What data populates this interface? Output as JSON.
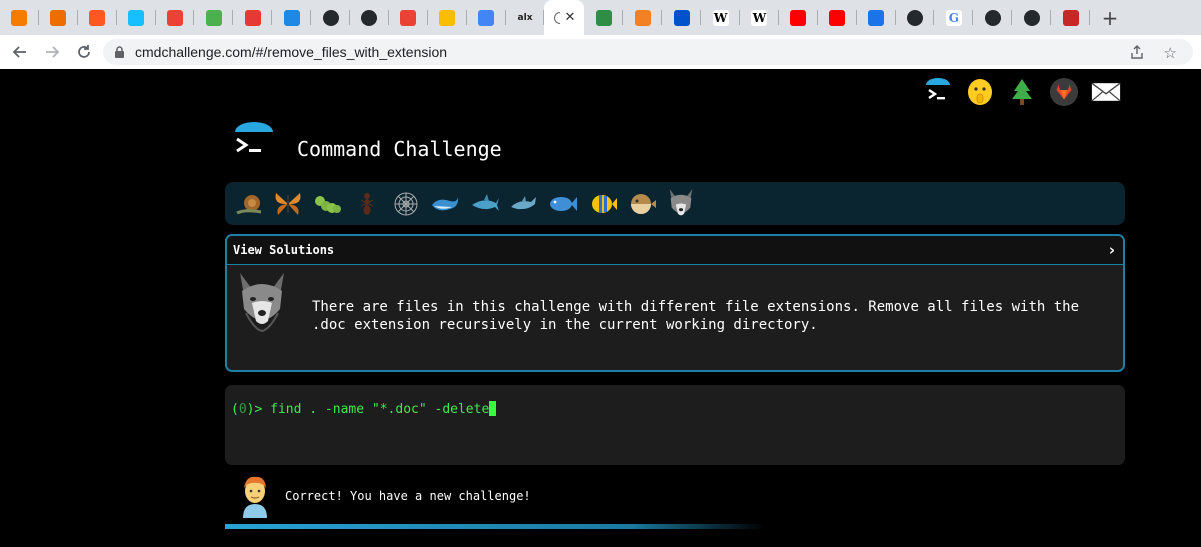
{
  "browser": {
    "tabs": [
      {
        "icon": "orange-cube-favicon",
        "color": "#f57c00"
      },
      {
        "icon": "orange-cube-favicon",
        "color": "#ef6c00"
      },
      {
        "icon": "wave-favicon",
        "color": "#ff5722"
      },
      {
        "icon": "airtable-favicon",
        "color": "#18bfff"
      },
      {
        "icon": "gmail-favicon",
        "color": "#ea4335"
      },
      {
        "icon": "school-favicon",
        "color": "#4caf50"
      },
      {
        "icon": "slash-favicon",
        "color": "#e53935"
      },
      {
        "icon": "t-favicon",
        "color": "#1e88e5"
      },
      {
        "icon": "github-favicon",
        "color": "#24292e"
      },
      {
        "icon": "github-favicon",
        "color": "#24292e"
      },
      {
        "icon": "gmail-favicon",
        "color": "#ea4335"
      },
      {
        "icon": "drive-favicon",
        "color": "#fbbc04"
      },
      {
        "icon": "docs-favicon",
        "color": "#4285f4"
      },
      {
        "icon": "alx-favicon",
        "color": "#222222",
        "text": "alx"
      },
      {
        "icon": "cmdchallenge-favicon",
        "active": true
      },
      {
        "icon": "gfg-favicon",
        "color": "#2f8d46"
      },
      {
        "icon": "stackoverflow-favicon",
        "color": "#f48024"
      },
      {
        "icon": "jira-favicon",
        "color": "#0052cc"
      },
      {
        "icon": "wikipedia-favicon",
        "color": "#000000",
        "text": "W"
      },
      {
        "icon": "wikipedia-favicon",
        "color": "#000000",
        "text": "W"
      },
      {
        "icon": "youtube-favicon",
        "color": "#ff0000"
      },
      {
        "icon": "youtube-favicon",
        "color": "#ff0000"
      },
      {
        "icon": "download-favicon",
        "color": "#1a73e8"
      },
      {
        "icon": "github-favicon",
        "color": "#24292e"
      },
      {
        "icon": "google-favicon",
        "color": "#4285f4",
        "text": "G"
      },
      {
        "icon": "github-favicon",
        "color": "#24292e"
      },
      {
        "icon": "github-favicon",
        "color": "#24292e"
      },
      {
        "icon": "red-square-favicon",
        "color": "#c62828"
      }
    ],
    "active_tab_close": "✕",
    "new_tab": "+",
    "url": "cmdchallenge.com/#/remove_files_with_extension"
  },
  "header": {
    "title": "Command Challenge",
    "top_icons": [
      "terminal-icon",
      "shushing-face-icon",
      "tree-icon",
      "gitlab-icon",
      "mail-icon"
    ]
  },
  "levels": [
    "snail-icon",
    "butterfly-icon",
    "caterpillar-icon",
    "ant-icon",
    "spider-web-icon",
    "whale-icon",
    "shark-icon",
    "dolphin-icon",
    "fish-icon",
    "tropical-fish-icon",
    "blowfish-icon",
    "wolf-icon"
  ],
  "challenge": {
    "header_label": "View Solutions",
    "chevron": "›",
    "description_line1": "There are files in this challenge with different file extensions. Remove all files with the",
    "description_line2": ".doc extension recursively in the current working directory."
  },
  "terminal": {
    "prompt_open": "(",
    "prompt_num": "0",
    "prompt_close": ")> ",
    "command": "find . -name \"*.doc\" -delete"
  },
  "result": {
    "message": "Correct! You have a new challenge!"
  },
  "colors": {
    "accent": "#1e7fa7",
    "terminal_text": "#3eea4e",
    "level_bar": "#0b2530"
  }
}
